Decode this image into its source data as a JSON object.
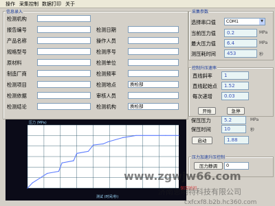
{
  "menu": [
    "操作",
    "采集控制",
    "数据打印",
    "关于"
  ],
  "info": {
    "title": "信息录入",
    "left_fields": [
      {
        "label": "检测机构",
        "value": ""
      },
      {
        "label": "报告编号",
        "value": ""
      },
      {
        "label": "产品名称",
        "value": ""
      },
      {
        "label": "规格型号",
        "value": ""
      },
      {
        "label": "原材料",
        "value": ""
      },
      {
        "label": "制造厂商",
        "value": ""
      },
      {
        "label": "检测项目",
        "value": ""
      },
      {
        "label": "检测依据",
        "value": ""
      },
      {
        "label": "检测结论",
        "value": ""
      }
    ],
    "right_fields": [
      {
        "label": "检测日期",
        "value": ""
      },
      {
        "label": "操作人员",
        "value": ""
      },
      {
        "label": "检测序号",
        "value": ""
      },
      {
        "label": "检测单位",
        "value": ""
      },
      {
        "label": "检测频率",
        "value": ""
      },
      {
        "label": "检测地点",
        "value": "质检部"
      },
      {
        "label": "审核人员",
        "value": ""
      },
      {
        "label": "检测机构",
        "value": "质检部"
      }
    ]
  },
  "collect": {
    "title": "采集参数",
    "port_label": "选择串口值",
    "port_value": "COM1",
    "rows": [
      {
        "label": "当前压力值",
        "value": "0.2",
        "unit": "MPa"
      },
      {
        "label": "最大压力值",
        "value": "6.4",
        "unit": "MPa"
      },
      {
        "label": "测压耗时间",
        "value": "453",
        "unit": "秒"
      }
    ]
  },
  "rate": {
    "title": "控制升压速率",
    "rows": [
      {
        "label": "直线斜率",
        "value": "1"
      },
      {
        "label": "直线起始点",
        "value": "1.52"
      },
      {
        "label": "每次递增",
        "value": "0.03"
      }
    ],
    "start_button": "开始",
    "stop_button": "急停"
  },
  "hold": {
    "rows": [
      {
        "label": "保压压力",
        "value": "5.2",
        "unit": "MPa"
      },
      {
        "label": "保压时间",
        "value": "10",
        "unit": "秒"
      }
    ],
    "start_button": "启动",
    "start_value": "1.88"
  },
  "release": {
    "title": "压力加速升压控制",
    "button": "压力静调",
    "value": "0"
  },
  "watermark": {
    "line1": "www.zgwjw66.com",
    "line2": "济南思明特科技有限公司",
    "line3": "cxfcxf8.b2b.hc360.com",
    "stamp": "保压时间"
  },
  "chart_data": {
    "type": "line",
    "title": "压力 (MPa)",
    "xlabel": "测试 (时间/秒)",
    "ylabel": "",
    "series": [
      {
        "x": [
          0,
          15,
          40,
          60,
          95,
          105,
          140,
          150,
          185,
          200,
          230,
          245,
          290,
          330,
          420,
          460
        ],
        "y": [
          0,
          0.5,
          1.0,
          1.4,
          1.6,
          2.4,
          2.6,
          3.3,
          3.5,
          4.1,
          4.2,
          4.4,
          4.8,
          5.0,
          5.0,
          5.0
        ]
      }
    ],
    "xlim": [
      0,
      460
    ],
    "ylim": [
      0,
      6
    ],
    "grid": true
  },
  "colors": {
    "accent": "#1a3c9c",
    "readout": "#3850b8",
    "chart_line": "#5b7cff",
    "chart_grid": "#16465a"
  }
}
